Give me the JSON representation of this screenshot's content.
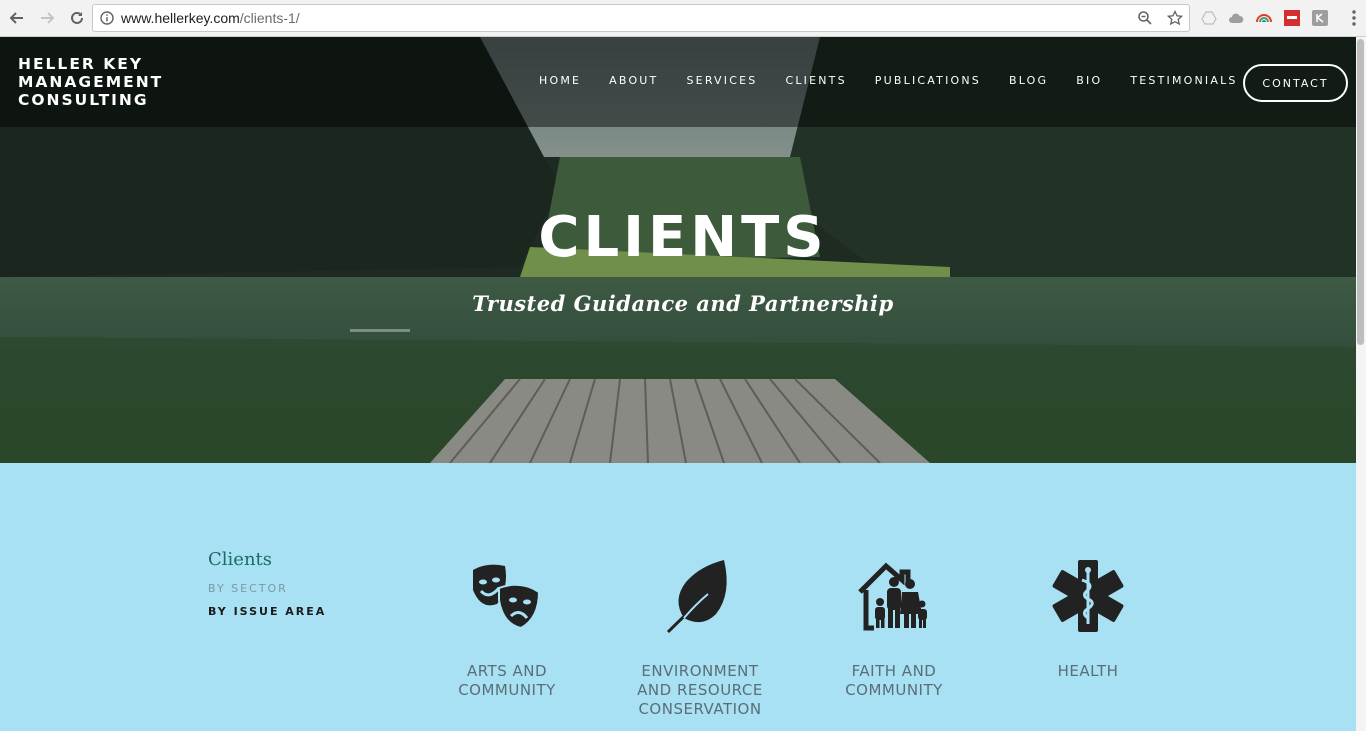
{
  "browser": {
    "url_domain": "www.hellerkey.com",
    "url_path": "/clients-1/"
  },
  "site": {
    "brand_lines": [
      "HELLER KEY",
      "MANAGEMENT",
      "CONSULTING"
    ],
    "nav": [
      "HOME",
      "ABOUT",
      "SERVICES",
      "CLIENTS",
      "PUBLICATIONS",
      "BLOG",
      "BIO",
      "TESTIMONIALS"
    ],
    "contact_label": "CONTACT"
  },
  "hero": {
    "title": "CLIENTS",
    "subtitle": "Trusted Guidance and Partnership"
  },
  "sidebar": {
    "title": "Clients",
    "links": [
      "BY SECTOR",
      "BY ISSUE AREA"
    ]
  },
  "categories": [
    {
      "label": "ARTS AND COMMUNITY",
      "icon": "theater-masks-icon"
    },
    {
      "label": "ENVIRONMENT AND RESOURCE CONSERVATION",
      "icon": "leaf-icon"
    },
    {
      "label": "FAITH AND COMMUNITY",
      "icon": "family-home-icon"
    },
    {
      "label": "HEALTH",
      "icon": "star-of-life-icon"
    }
  ],
  "colors": {
    "content_bg": "#a8e0f4",
    "sidebar_title": "#1c6b64",
    "category_text": "#5a6e75",
    "icon": "#222222"
  }
}
